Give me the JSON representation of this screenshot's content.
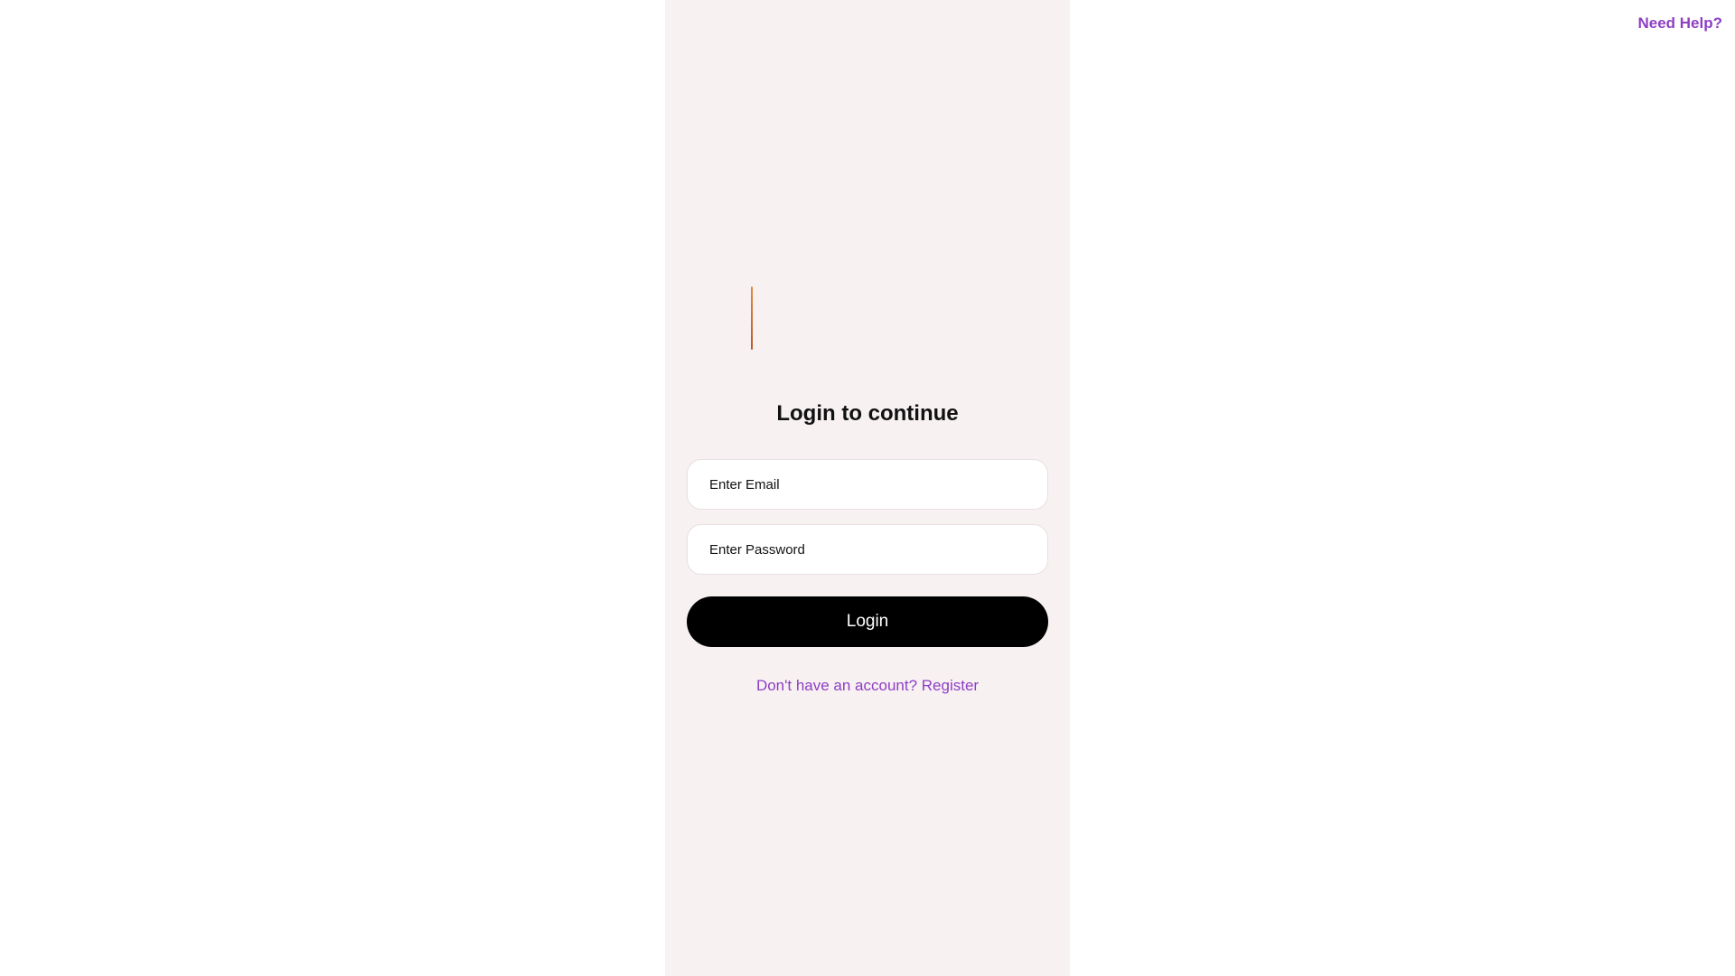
{
  "header": {
    "help_label": "Need Help?"
  },
  "login": {
    "title": "Login to continue",
    "email_placeholder": "Enter Email",
    "email_value": "",
    "password_placeholder": "Enter Password",
    "password_value": "",
    "submit_label": "Login",
    "register_link": "Don't have an account? Register"
  },
  "colors": {
    "accent": "#8e3fc4",
    "panel_background": "#f7f1f2",
    "button_background": "#000000",
    "logo_mark": "#c8672f"
  },
  "icons": {
    "logo": "brand-logo-icon"
  }
}
